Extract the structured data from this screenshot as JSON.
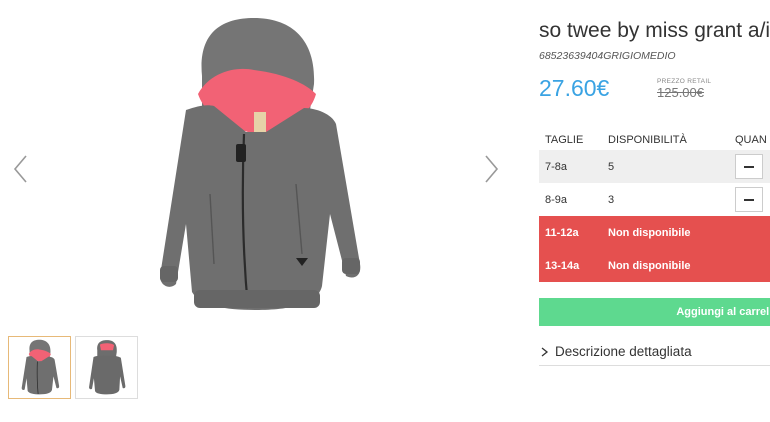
{
  "product": {
    "title": "so twee by miss grant a/i -",
    "sku": "68523639404GRIGIOMEDIO",
    "price": "27.60€",
    "retail_label": "PREZZO RETAIL",
    "retail_price": "125.00€"
  },
  "sizes_table": {
    "headers": {
      "size": "TAGLIE",
      "availability": "DISPONIBILITÀ",
      "quantity": "QUAN"
    },
    "rows": [
      {
        "size": "7-8a",
        "availability": "5"
      },
      {
        "size": "8-9a",
        "availability": "3"
      },
      {
        "size": "11-12a",
        "availability": "Non disponibile"
      },
      {
        "size": "13-14a",
        "availability": "Non disponibile"
      }
    ]
  },
  "actions": {
    "add_to_cart": "Aggiungi al carrello",
    "details": "Descrizione dettagliata"
  },
  "icons": [
    "chevron-left-icon",
    "chevron-right-icon",
    "minus-icon",
    "chevron-right-small-icon"
  ],
  "colors": {
    "price": "#3aa3e3",
    "unavailable_row": "#e5504f",
    "cart_button": "#5ed98f",
    "active_thumb_border": "#e7b978"
  }
}
